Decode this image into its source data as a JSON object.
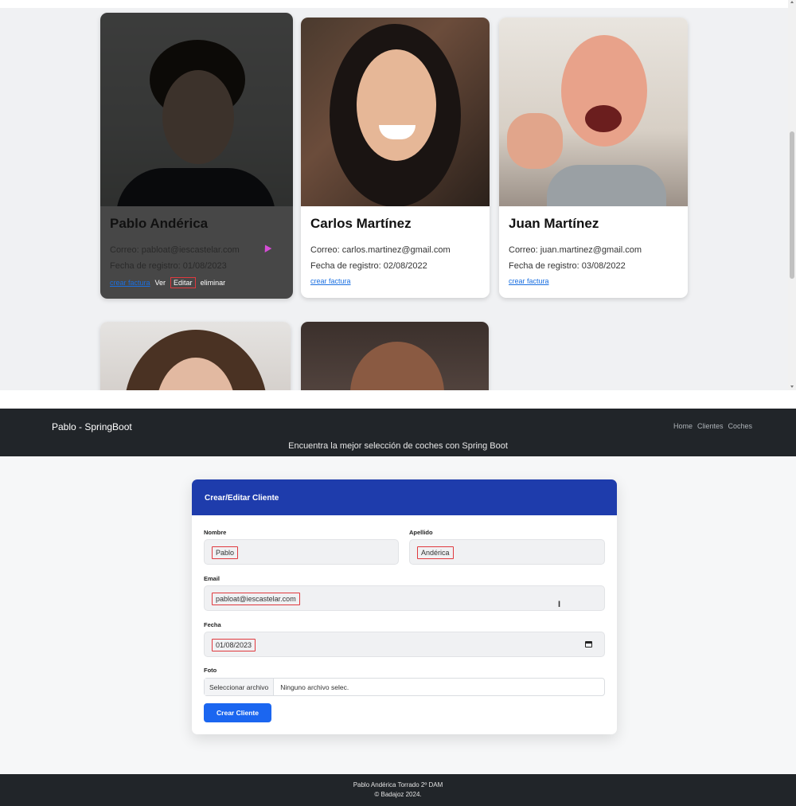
{
  "cards": [
    {
      "name": "Pablo Andérica",
      "email": "Correo: pabloat@iescastelar.com",
      "date": "Fecha de registro: 01/08/2023",
      "actions": {
        "invoice": "crear factura",
        "view": "Ver",
        "edit": "Editar",
        "delete": "eliminar"
      }
    },
    {
      "name": "Carlos Martínez",
      "email": "Correo: carlos.martinez@gmail.com",
      "date": "Fecha de registro: 02/08/2022",
      "actions": {
        "invoice": "crear factura"
      }
    },
    {
      "name": "Juan Martínez",
      "email": "Correo: juan.martinez@gmail.com",
      "date": "Fecha de registro: 03/08/2022",
      "actions": {
        "invoice": "crear factura"
      }
    }
  ],
  "navbar": {
    "brand": "Pablo - SpringBoot",
    "links": [
      "Home",
      "Clientes",
      "Coches"
    ],
    "tagline": "Encuentra la mejor selección de coches con Spring Boot"
  },
  "form": {
    "title": "Crear/Editar Cliente",
    "nombre_label": "Nombre",
    "nombre_value": "Pablo",
    "apellido_label": "Apellido",
    "apellido_value": "Andérica",
    "email_label": "Email",
    "email_value": "pabloat@iescastelar.com",
    "fecha_label": "Fecha",
    "fecha_value": "01/08/2023",
    "foto_label": "Foto",
    "file_button": "Seleccionar archivo",
    "file_status": "Ninguno archivo selec.",
    "submit": "Crear Cliente"
  },
  "footer": {
    "line1": "Pablo Andérica Torrado 2º DAM",
    "line2": "© Badajoz 2024."
  },
  "colors": {
    "navbar_bg": "#212529",
    "form_header": "#1e3cac",
    "primary_button": "#1b66f0",
    "highlight_box": "#e0393e",
    "link": "#1a6fe0"
  }
}
